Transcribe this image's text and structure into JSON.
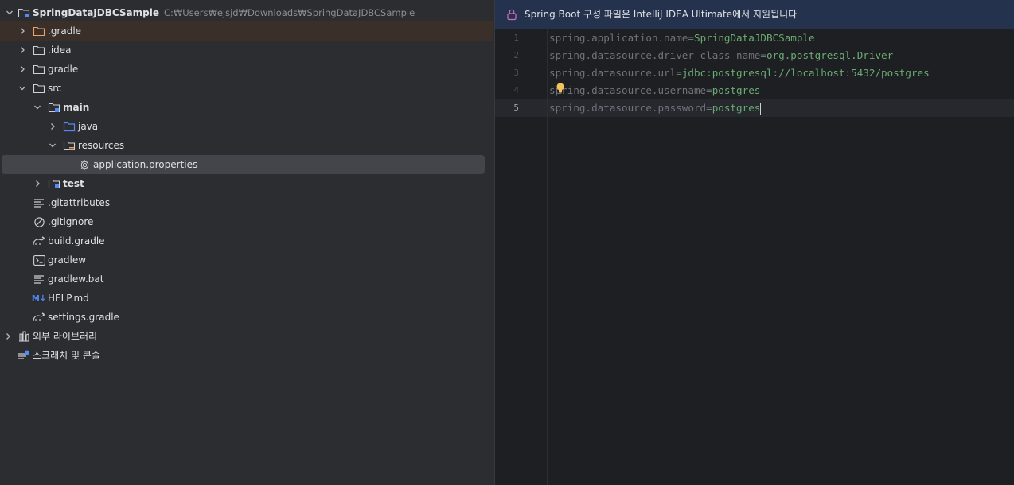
{
  "tree": {
    "root": {
      "label": "SpringDataJDBCSample",
      "path": "C:₩Users₩ejsjd₩Downloads₩SpringDataJDBCSample"
    },
    "items": [
      {
        "label": ".gradle"
      },
      {
        "label": ".idea"
      },
      {
        "label": "gradle"
      },
      {
        "label": "src"
      },
      {
        "label": "main"
      },
      {
        "label": "java"
      },
      {
        "label": "resources"
      },
      {
        "label": "application.properties"
      },
      {
        "label": "test"
      },
      {
        "label": ".gitattributes"
      },
      {
        "label": ".gitignore"
      },
      {
        "label": "build.gradle"
      },
      {
        "label": "gradlew"
      },
      {
        "label": "gradlew.bat"
      },
      {
        "label": "HELP.md"
      },
      {
        "label": "settings.gradle"
      }
    ],
    "external_libraries": "외부 라이브러리",
    "scratches": "스크래치 및 콘솔",
    "md_badge": "M↓"
  },
  "editor": {
    "banner": "Spring Boot 구성 파일은 IntelliJ IDEA Ultimate에서 지원됩니다",
    "lines": [
      {
        "num": "1",
        "key": "spring.application.name=",
        "value": "SpringDataJDBCSample"
      },
      {
        "num": "2",
        "key": "spring.datasource.driver-class-name=",
        "value": "org.postgresql.Driver"
      },
      {
        "num": "3",
        "key": "spring.datasource.url=",
        "value": "jdbc:postgresql://localhost:5432/postgres"
      },
      {
        "num": "4",
        "key": "spring.datasource.username=",
        "value": "postgres"
      },
      {
        "num": "5",
        "key": "spring.datasource.password=",
        "value": "postgres"
      }
    ],
    "current_line": "5"
  },
  "colors": {
    "tree_bg": "#2b2d30",
    "editor_bg": "#1e1f22",
    "banner_bg": "#25324d",
    "key_text": "#6f737a",
    "value_text": "#6aab73",
    "excluded_folder": "#e9a369",
    "selected_row": "#43454a"
  }
}
